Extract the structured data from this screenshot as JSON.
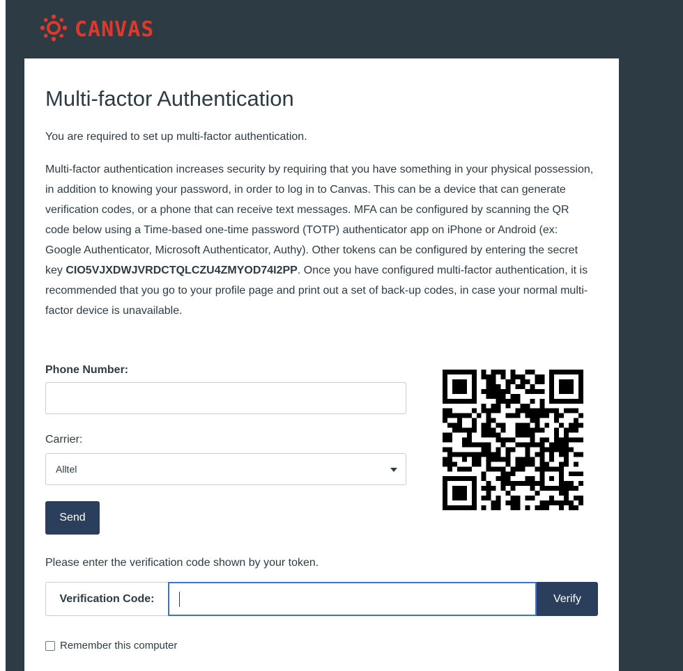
{
  "header": {
    "logo_text": "CANVAS",
    "brand_color": "#e0392b"
  },
  "page": {
    "title": "Multi-factor Authentication",
    "intro": "You are required to set up multi-factor authentication.",
    "desc_part1": "Multi-factor authentication increases security by requiring that you have something in your physical possession, in addition to knowing your password, in order to log in to Canvas. This can be a device that can generate verification codes, or a phone that can receive text messages. MFA can be configured by scanning the QR code below using a Time-based one-time password (TOTP) authenticator app on iPhone or Android (ex: Google Authenticator, Microsoft Authenticator, Authy). Other tokens can be configured by entering the secret key ",
    "secret_key": "CIO5VJXDWJVRDCTQLCZU4ZMYOD74I2PP",
    "desc_part2": ". Once you have configured multi-factor authentication, it is recommended that you go to your profile page and print out a set of back-up codes, in case your normal multi-factor device is unavailable."
  },
  "form": {
    "phone_label": "Phone Number:",
    "phone_value": "",
    "carrier_label": "Carrier:",
    "carrier_selected": "Alltel",
    "send_label": "Send",
    "prompt": "Please enter the verification code shown by your token.",
    "verification_label": "Verification Code:",
    "verification_value": "",
    "verify_label": "Verify",
    "remember_label": "Remember this computer"
  },
  "icons": {
    "logo": "canvas-logo-icon",
    "qr": "qr-code-icon",
    "dropdown": "chevron-down-icon",
    "checkbox": "checkbox-icon"
  },
  "colors": {
    "header_bg": "#2d3b45",
    "button_bg": "#2b3f5c",
    "focus_border": "#3b73d1"
  }
}
